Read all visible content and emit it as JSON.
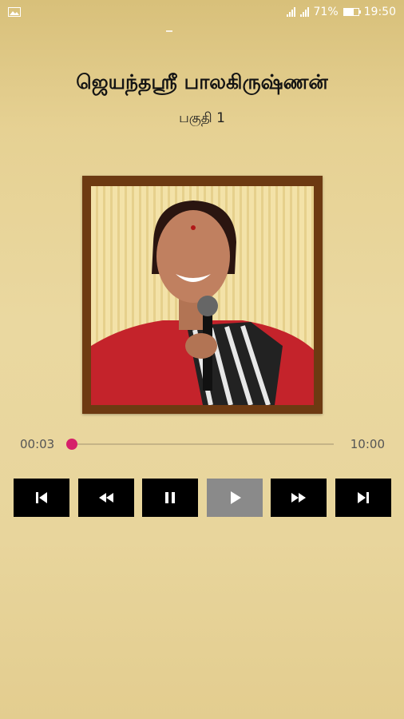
{
  "status_bar": {
    "battery_percent": "71%",
    "time": "19:50",
    "battery_level": 0.71
  },
  "player": {
    "title": "ஜெயந்தஸ்ரீ பாலகிருஷ்ணன்",
    "subtitle": "பகுதி 1",
    "current_time": "00:03",
    "total_time": "10:00",
    "progress": 0.005
  },
  "controls": [
    {
      "name": "skip-previous",
      "icon": "skip-previous-icon"
    },
    {
      "name": "rewind",
      "icon": "rewind-icon"
    },
    {
      "name": "pause",
      "icon": "pause-icon"
    },
    {
      "name": "play",
      "icon": "play-icon",
      "active": true
    },
    {
      "name": "fast-forward",
      "icon": "fast-forward-icon"
    },
    {
      "name": "skip-next",
      "icon": "skip-next-icon"
    }
  ],
  "colors": {
    "accent": "#d6206a",
    "button": "#000000",
    "button_active": "#8a8a8a"
  }
}
